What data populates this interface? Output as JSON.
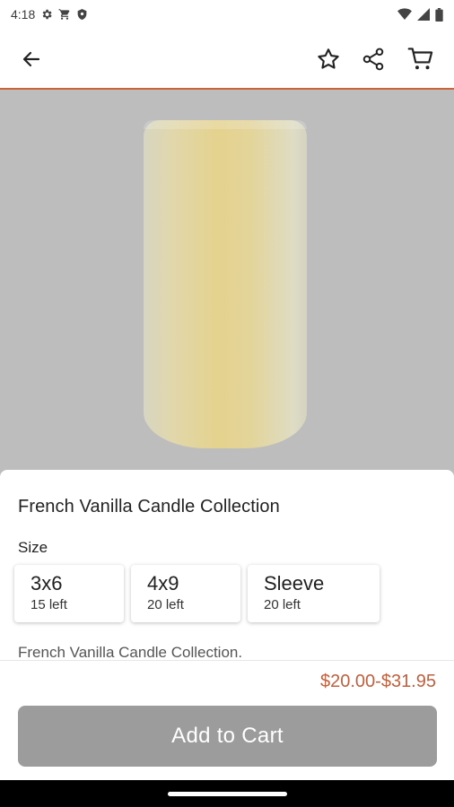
{
  "status_bar": {
    "time": "4:18",
    "icons_left": [
      "settings-icon",
      "cart-notification-icon",
      "shield-icon"
    ],
    "icons_right": [
      "wifi-icon",
      "cellular-signal-icon",
      "battery-icon"
    ]
  },
  "app_bar": {
    "icons": [
      "back-arrow-icon",
      "star-icon",
      "share-icon",
      "cart-icon"
    ]
  },
  "product": {
    "title": "French Vanilla Candle Collection",
    "size_label": "Size",
    "options": [
      {
        "name": "3x6",
        "stock": "15 left"
      },
      {
        "name": "4x9",
        "stock": "20 left"
      },
      {
        "name": "Sleeve",
        "stock": "20 left"
      }
    ],
    "description": "French Vanilla Candle Collection."
  },
  "footer": {
    "price": "$20.00-$31.95",
    "add_to_cart_label": "Add to Cart"
  },
  "colors": {
    "accent": "#c8643c",
    "price": "#c0603e",
    "button_disabled": "#9c9c9c",
    "hero_background": "#bdbdbd"
  }
}
